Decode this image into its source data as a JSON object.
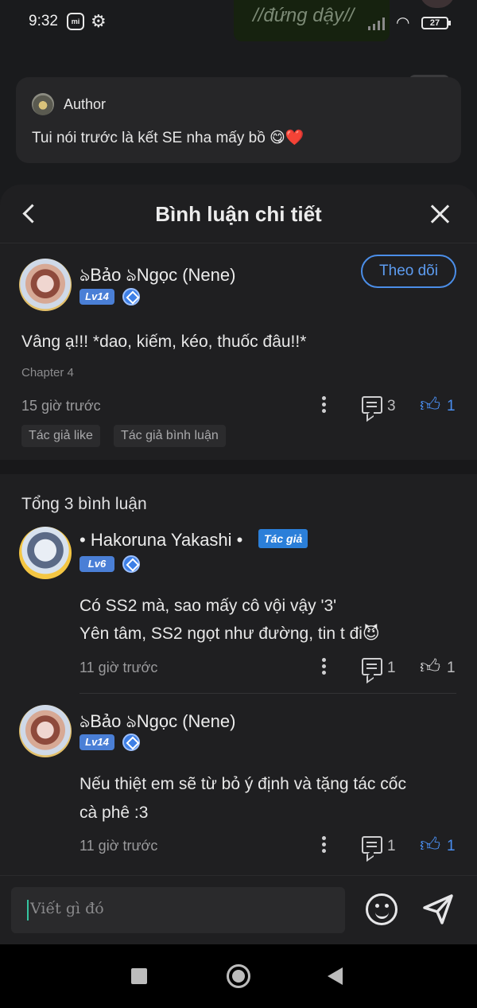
{
  "status_bar": {
    "time": "9:32",
    "mi_label": "mi",
    "battery": "27",
    "background_text": "//đứng dậy//"
  },
  "author_card": {
    "name": "Author",
    "message": "Tui nói trước là kết SE nha mấy bồ 😋❤️"
  },
  "sheet": {
    "title": "Bình luận chi tiết"
  },
  "main_comment": {
    "username": "ঌBảo ঌNgọc (Nene)",
    "level": "Lv14",
    "follow_label": "Theo dõi",
    "text": "Vâng ạ!!! *dao, kiếm, kéo, thuốc đâu!!*",
    "chapter": "Chapter 4",
    "time": "15 giờ trước",
    "reply_count": "3",
    "like_count": "1",
    "liked": true,
    "tags": [
      "Tác giả like",
      "Tác giả bình luận"
    ]
  },
  "replies": {
    "total_label": "Tổng 3 bình luận",
    "items": [
      {
        "username": "• Hakoruna Yakashi •",
        "author_badge": "Tác giả",
        "level": "Lv6",
        "text_lines": [
          "Có SS2 mà, sao mấy cô vội vậy '3'",
          "Yên tâm, SS2 ngọt như đường, tin t đi😈"
        ],
        "time": "11 giờ trước",
        "reply_count": "1",
        "like_count": "1",
        "liked": false
      },
      {
        "username": "ঌBảo ঌNgọc (Nene)",
        "level": "Lv14",
        "text_lines": [
          "Nếu thiệt em sẽ từ bỏ ý định và tặng tác cốc",
          "cà phê :3"
        ],
        "time": "11 giờ trước",
        "reply_count": "1",
        "like_count": "1",
        "liked": true
      }
    ]
  },
  "input": {
    "placeholder": "Viết gì đó"
  },
  "colors": {
    "accent": "#4a8ef0",
    "author_badge": "#2b7fd9",
    "level_badge": "#4a7fd6"
  }
}
